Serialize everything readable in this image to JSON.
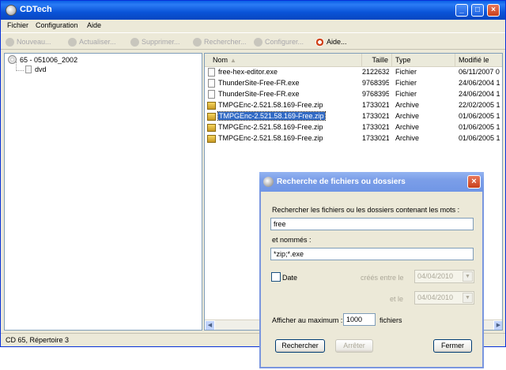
{
  "window": {
    "title": "CDTech"
  },
  "menu": [
    "Fichier",
    "Configuration",
    "Aide"
  ],
  "toolbar": [
    "Nouveau...",
    "Actualiser...",
    "Supprimer...",
    "Rechercher...",
    "Configurer...",
    "Aide..."
  ],
  "tree": {
    "root": "65 - 051006_2002",
    "child": "dvd"
  },
  "list": {
    "columns": [
      "Nom",
      "Taille",
      "Type",
      "Modifié le"
    ],
    "rows": [
      {
        "name": "free-hex-editor.exe",
        "size": "2122632",
        "type": "Fichier",
        "modified": "06/11/2007 0"
      },
      {
        "name": "ThunderSite-Free-FR.exe",
        "size": "9768395",
        "type": "Fichier",
        "modified": "24/06/2004 1"
      },
      {
        "name": "ThunderSite-Free-FR.exe",
        "size": "9768395",
        "type": "Fichier",
        "modified": "24/06/2004 1"
      },
      {
        "name": "TMPGEnc-2.521.58.169-Free.zip",
        "size": "1733021",
        "type": "Archive",
        "modified": "22/02/2005 1"
      },
      {
        "name": "TMPGEnc-2.521.58.169-Free.zip",
        "size": "1733021",
        "type": "Archive",
        "modified": "01/06/2005 1"
      },
      {
        "name": "TMPGEnc-2.521.58.169-Free.zip",
        "size": "1733021",
        "type": "Archive",
        "modified": "01/06/2005 1"
      },
      {
        "name": "TMPGEnc-2.521.58.169-Free.zip",
        "size": "1733021",
        "type": "Archive",
        "modified": "01/06/2005 1"
      }
    ]
  },
  "status": "CD 65, Répertoire 3",
  "dialog": {
    "title": "Recherche de fichiers ou dossiers",
    "search_label": "Rechercher les fichiers ou les dossiers contenant les mots :",
    "search_value": "free",
    "names_label": "et nommés :",
    "names_value": "*zip;*.exe",
    "date_label": "Date",
    "created_between_label": "créés entre le",
    "and_label": "et le",
    "date_from": "04/04/2010",
    "date_to": "04/04/2010",
    "max_label": "Afficher au maximum :",
    "max_value": "1000",
    "max_unit": "fichiers",
    "search_button": "Rechercher",
    "stop_button": "Arrêter",
    "close_button": "Fermer"
  }
}
